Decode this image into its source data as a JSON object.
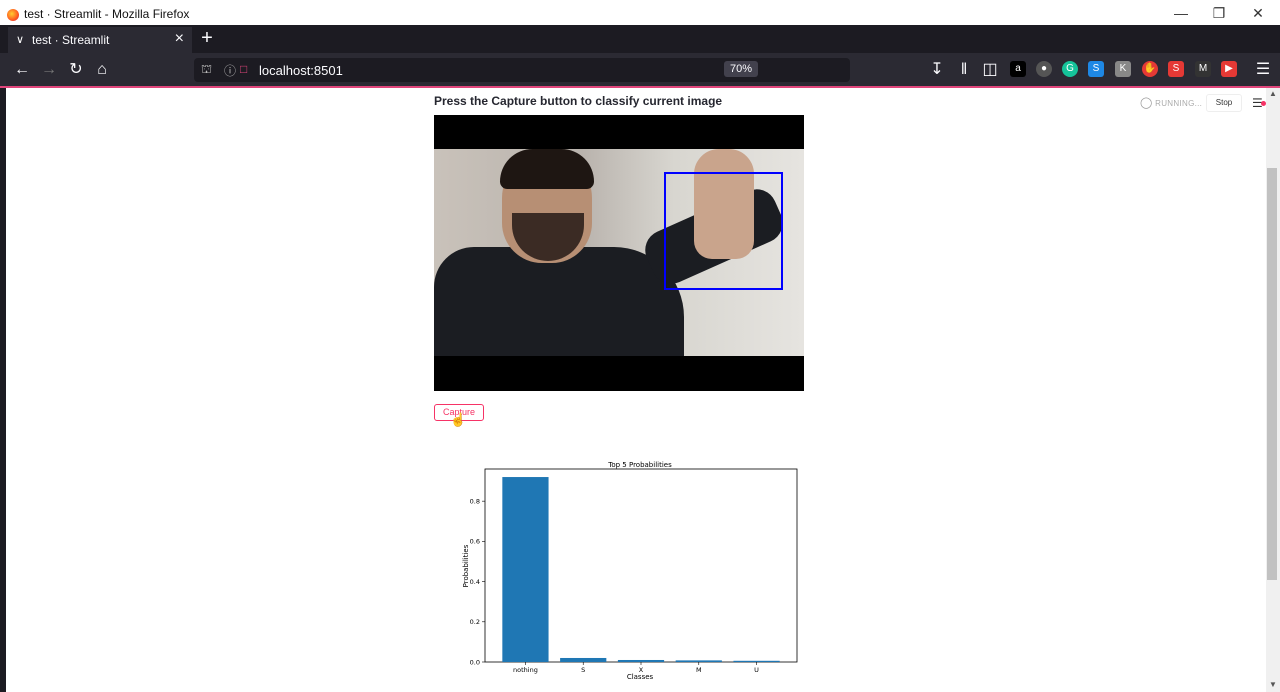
{
  "window": {
    "title": "test · Streamlit - Mozilla Firefox"
  },
  "tab": {
    "label": "test · Streamlit"
  },
  "address": {
    "url": "localhost:8501",
    "zoom": "70%"
  },
  "streamlit": {
    "status": "RUNNING...",
    "stop_label": "Stop",
    "heading": "Press the Capture button to classify current image",
    "capture_label": "Capture"
  },
  "chart_data": {
    "type": "bar",
    "title": "Top 5 Probabilities",
    "xlabel": "Classes",
    "ylabel": "Probabilities",
    "categories": [
      "nothing",
      "S",
      "X",
      "M",
      "U"
    ],
    "values": [
      0.92,
      0.02,
      0.01,
      0.008,
      0.006
    ],
    "ylim": [
      0,
      0.96
    ],
    "yticks": [
      "0.0",
      "0.2",
      "0.4",
      "0.6",
      "0.8"
    ],
    "bar_color": "#1f77b4",
    "grid": false
  }
}
